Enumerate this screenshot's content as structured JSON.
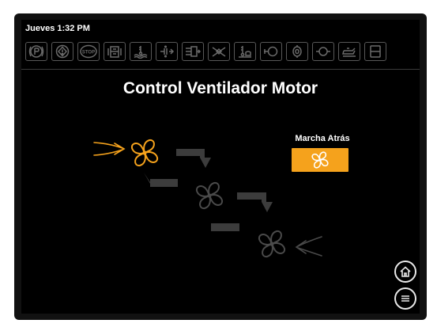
{
  "status": {
    "datetime": "Jueves 1:32 PM"
  },
  "indicators": [
    {
      "icon": "parking-brake-icon"
    },
    {
      "icon": "warning-diamond-icon"
    },
    {
      "icon": "stop-icon",
      "text": "STOP"
    },
    {
      "icon": "coolant-level-icon"
    },
    {
      "icon": "coolant-temperature-icon"
    },
    {
      "icon": "transmission-filter-icon"
    },
    {
      "icon": "air-filter-icon"
    },
    {
      "icon": "fan-restriction-icon"
    },
    {
      "icon": "oil-temperature-icon"
    },
    {
      "icon": "hydraulic-pressure-icon"
    },
    {
      "icon": "engine-oil-icon"
    },
    {
      "icon": "fuel-filter-icon"
    },
    {
      "icon": "oil-can-icon"
    },
    {
      "icon": "fuel-level-icon"
    }
  ],
  "page": {
    "title": "Control Ventilador Motor"
  },
  "reverse": {
    "label": "Marcha Atrás"
  },
  "colors": {
    "accent": "#f5a21c",
    "inactive": "#3c3c3c",
    "fan_inactive": "#4a4a4a",
    "text": "#ffffff",
    "indicator_off": "#6a6a6a"
  },
  "nav": {
    "home_icon": "home-icon",
    "menu_icon": "menu-icon"
  }
}
